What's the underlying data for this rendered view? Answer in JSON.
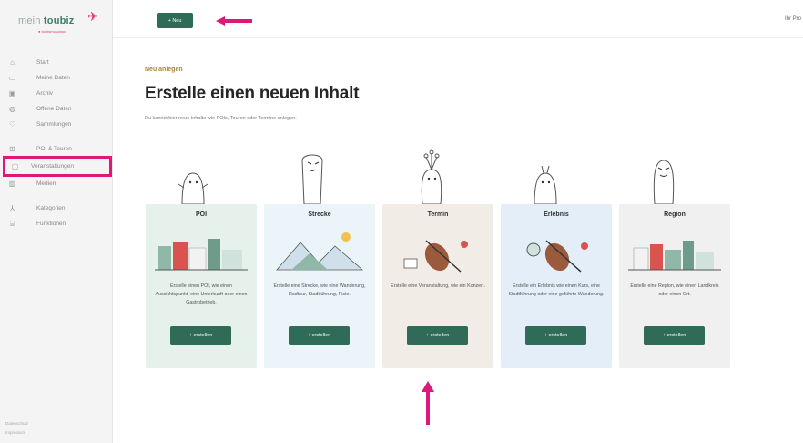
{
  "sidebar": {
    "logo": {
      "prefix": "mein",
      "brand": "toubiz",
      "sub": "● tourismuscloud"
    },
    "items": [
      {
        "label": "Start",
        "icon": "home-icon"
      },
      {
        "label": "Meine Daten",
        "icon": "inbox-icon"
      },
      {
        "label": "Archiv",
        "icon": "archive-icon"
      },
      {
        "label": "Offene Daten",
        "icon": "globe-icon"
      },
      {
        "label": "Sammlungen",
        "icon": "heart-icon"
      },
      {
        "label": "POI & Touren",
        "icon": "map-icon"
      },
      {
        "label": "Veranstaltungen",
        "icon": "calendar-icon"
      },
      {
        "label": "Medien",
        "icon": "image-icon"
      },
      {
        "label": "Kategorien",
        "icon": "tree-icon"
      },
      {
        "label": "Funktionen",
        "icon": "building-icon"
      }
    ],
    "footer": {
      "line1": "Datenschutz",
      "line2": "Impressum"
    }
  },
  "topbar": {
    "new_button": "+ Neu",
    "profile": "Ihr Pro"
  },
  "main": {
    "eyebrow": "Neu anlegen",
    "title": "Erstelle einen neuen Inhalt",
    "description": "Du kannst hier neue Inhalte wie POIs, Touren oder Termine anlegen.",
    "cards": [
      {
        "title": "POI",
        "text": "Erstelle einen POI, wie einen Aussichtspunkt, eine Unterkunft oder einen Gastrobetrieb.",
        "button": "+ erstellen",
        "bg": "#e7f1ec"
      },
      {
        "title": "Strecke",
        "text": "Erstelle eine Strecke, wie eine Wanderung, Radtour, Stadtführung, Piste.",
        "button": "+ erstellen",
        "bg": "#eaf4f9"
      },
      {
        "title": "Termin",
        "text": "Erstelle eine Veranstaltung, wie ein Konzert.",
        "button": "+ erstellen",
        "bg": "#f1ede6"
      },
      {
        "title": "Erlebnis",
        "text": "Erstelle ein Erlebnis wie einen Kurs, eine Stadtführung oder eine geführte Wanderung.",
        "button": "+ erstellen",
        "bg": "#e3eef8"
      },
      {
        "title": "Region",
        "text": "Erstelle eine Region, wie einen Landkreis oder einen Ort.",
        "button": "+ erstellen",
        "bg": "#f0f0f0"
      }
    ]
  },
  "colors": {
    "brand_green": "#2f6b57",
    "highlight_pink": "#e0177a",
    "eyebrow": "#a88545"
  }
}
